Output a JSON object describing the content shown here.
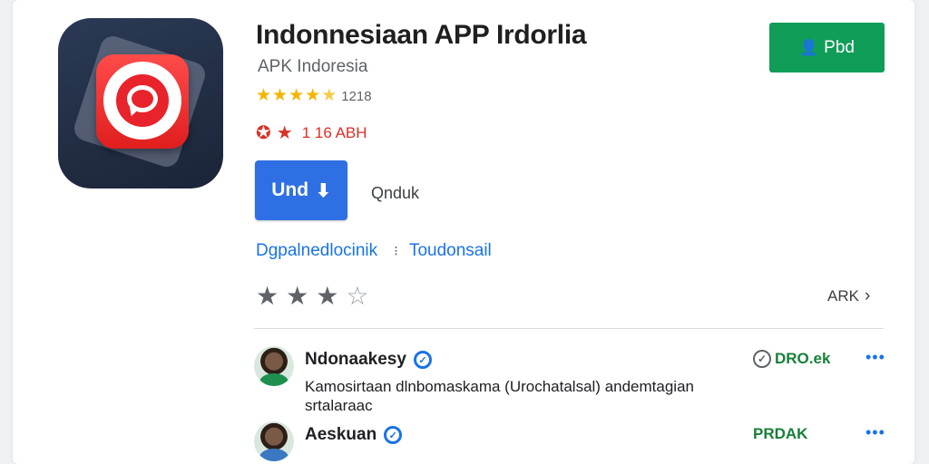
{
  "app": {
    "title": "Indonnesiaan APP Irdorlia",
    "subtitle": "APK Indoresia",
    "rating_count": "1218",
    "badge_text": "1 16 ABH",
    "install_label": "Und",
    "secondary_label": "Qnduk"
  },
  "top_action": {
    "label": "Pbd"
  },
  "links": {
    "developer": "Dgpalnedlocinik",
    "category": "Toudonsail"
  },
  "rating_input": {
    "filled_stars": 3,
    "total_stars": 4,
    "apk_link": "ARK"
  },
  "reviews": [
    {
      "name": "Ndonaakesy",
      "status": "DRO.ek",
      "text": "Kamosirtaan dlnbomaskama (Urochatalsal) andemtagian srtalaraac",
      "avatar_color": "#1e8f4f"
    },
    {
      "name": "Aeskuan",
      "status": "PRDAK",
      "text": "",
      "avatar_color": "#3a78c2"
    }
  ],
  "colors": {
    "install_blue": "#2f6fe4",
    "top_action_green": "#0f9d58",
    "star_gold": "#f4b400",
    "badge_red": "#d93025",
    "link_blue": "#1a73e8"
  },
  "icons": [
    "app-icon",
    "star-icon",
    "badge-star-icon",
    "download-arrow-icon",
    "person-icon",
    "chevron-right-icon",
    "verified-icon",
    "check-circle-icon",
    "more-icon"
  ]
}
